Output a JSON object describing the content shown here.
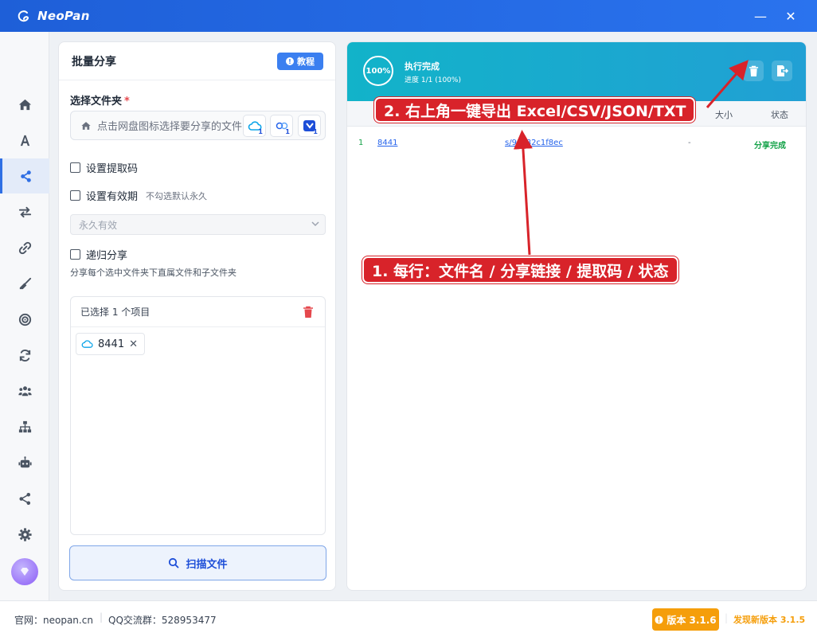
{
  "window": {
    "title": "NeoPan",
    "minimize_label": "—",
    "close_label": "✕"
  },
  "nav": {
    "items": [
      {
        "name": "home"
      },
      {
        "name": "font"
      },
      {
        "name": "share",
        "active": true
      },
      {
        "name": "transfer"
      },
      {
        "name": "link"
      },
      {
        "name": "clean"
      },
      {
        "name": "target"
      },
      {
        "name": "sync"
      },
      {
        "name": "users"
      },
      {
        "name": "sitemap"
      },
      {
        "name": "robot"
      },
      {
        "name": "share-alt"
      },
      {
        "name": "settings"
      }
    ]
  },
  "left_panel": {
    "title": "批量分享",
    "tutorial_label": "教程",
    "folder_label": "选择文件夹",
    "required_mark": "*",
    "folder_placeholder": "点击网盘图标选择要分享的文件夹",
    "cloud_badges": [
      "1",
      "1",
      "1"
    ],
    "set_code_label": "设置提取码",
    "set_expiry_label": "设置有效期",
    "expiry_hint": "不勾选默认永久",
    "expiry_select_value": "永久有效",
    "recursive_label": "递归分享",
    "recursive_hint": "分享每个选中文件夹下直属文件和子文件夹",
    "selected_title": "已选择 1 个项目",
    "selected_items": [
      {
        "name": "8441"
      }
    ],
    "scan_label": "扫描文件"
  },
  "right_panel": {
    "progress_percent": "100%",
    "status_title": "执行完成",
    "status_sub": "进度 1/1 (100%)",
    "columns": {
      "size": "大小",
      "status": "状态"
    },
    "rows": [
      {
        "index": "1",
        "name": "8441",
        "link": "s/9xe82c1f8ec",
        "size": "-",
        "status": "分享完成"
      }
    ]
  },
  "annotations": {
    "export_note": "2. 右上角一键导出 Excel/CSV/JSON/TXT",
    "row_note": "1. 每行：文件名 / 分享链接 / 提取码 / 状态"
  },
  "footer": {
    "site": "官网：neopan.cn",
    "separator": "|",
    "qq": "QQ交流群：528953477",
    "version": "版本 3.1.6",
    "new_version": "发现新版本 3.1.5"
  },
  "colors": {
    "primary": "#2f6fe4",
    "header_teal": "#12b3c9",
    "success": "#16a34a",
    "annotation_red": "#d8232a",
    "version_orange": "#f59e0b"
  }
}
